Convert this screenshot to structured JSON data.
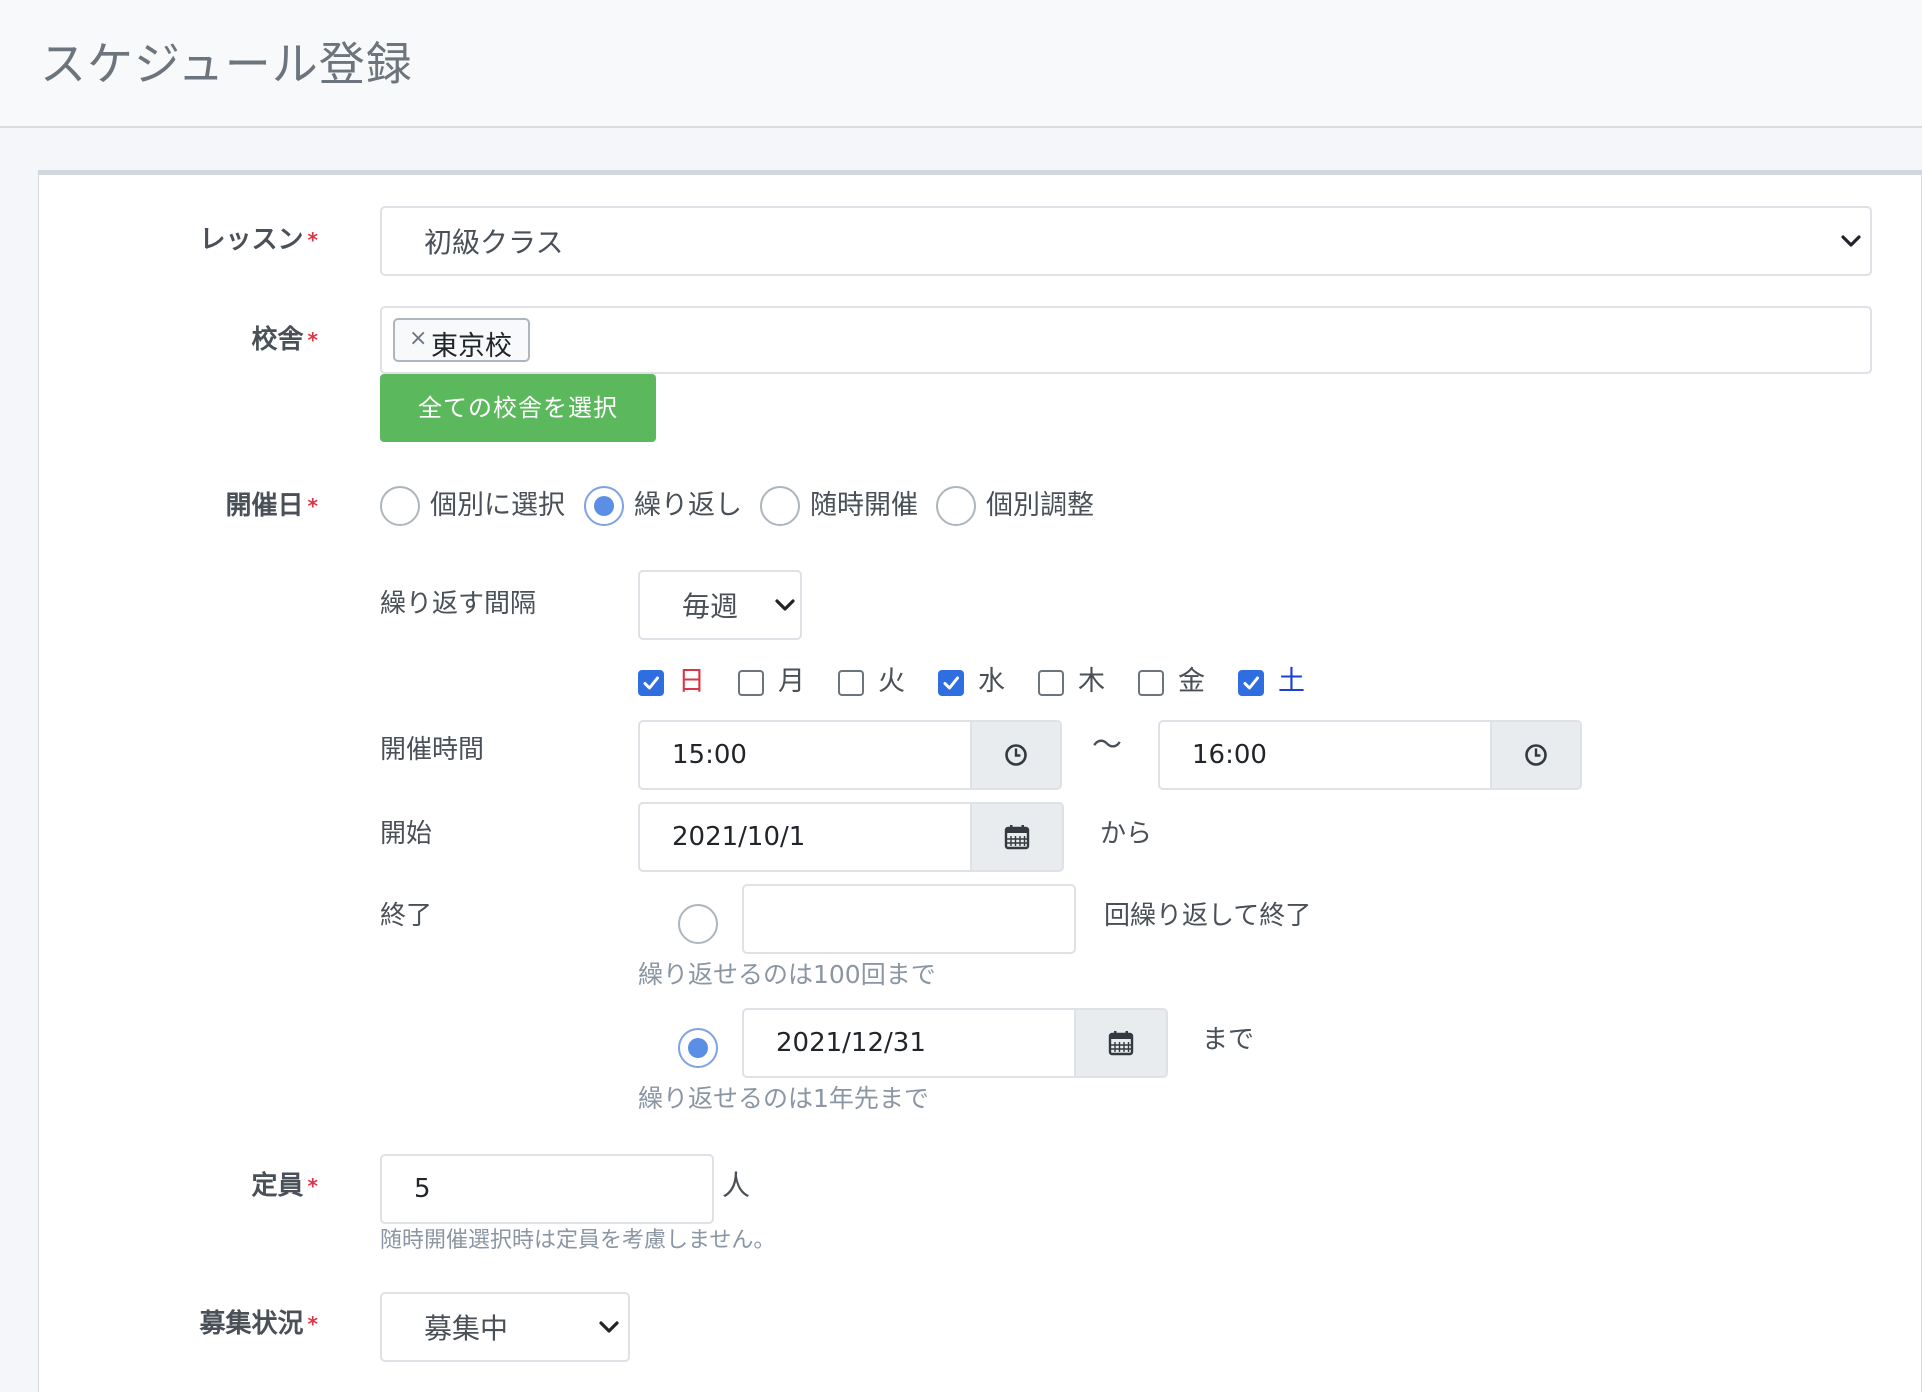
{
  "page": {
    "title": "スケジュール登録"
  },
  "form": {
    "required_mark": "*",
    "lesson": {
      "label": "レッスン",
      "value": "初級クラス"
    },
    "school": {
      "label": "校舎",
      "tags": [
        {
          "remove": "×",
          "text": "東京校"
        }
      ],
      "select_all_label": "全ての校舎を選択"
    },
    "date": {
      "label": "開催日",
      "options": [
        {
          "label": "個別に選択",
          "checked": false
        },
        {
          "label": "繰り返し",
          "checked": true
        },
        {
          "label": "随時開催",
          "checked": false
        },
        {
          "label": "個別調整",
          "checked": false
        }
      ]
    },
    "repeat": {
      "interval_label": "繰り返す間隔",
      "interval_value": "毎週",
      "weekdays": [
        {
          "label": "日",
          "checked": true,
          "color": "#dc3545"
        },
        {
          "label": "月",
          "checked": false,
          "color": "#495057"
        },
        {
          "label": "火",
          "checked": false,
          "color": "#495057"
        },
        {
          "label": "水",
          "checked": true,
          "color": "#495057"
        },
        {
          "label": "木",
          "checked": false,
          "color": "#495057"
        },
        {
          "label": "金",
          "checked": false,
          "color": "#495057"
        },
        {
          "label": "土",
          "checked": true,
          "color": "#1e3fd6"
        }
      ],
      "time_label": "開催時間",
      "time_start": "15:00",
      "time_sep": "〜",
      "time_end": "16:00",
      "start_label": "開始",
      "start_date": "2021/10/1",
      "start_suffix": "から",
      "end_label": "終了",
      "end_count_value": "",
      "end_count_suffix": "回繰り返して終了",
      "end_count_help": "繰り返せるのは100回まで",
      "end_count_checked": false,
      "end_date_value": "2021/12/31",
      "end_date_suffix": "まで",
      "end_date_help": "繰り返せるのは1年先まで",
      "end_date_checked": true
    },
    "capacity": {
      "label": "定員",
      "value": "5",
      "unit": "人",
      "help": "随時開催選択時は定員を考慮しません。"
    },
    "status": {
      "label": "募集状況",
      "value": "募集中"
    }
  }
}
